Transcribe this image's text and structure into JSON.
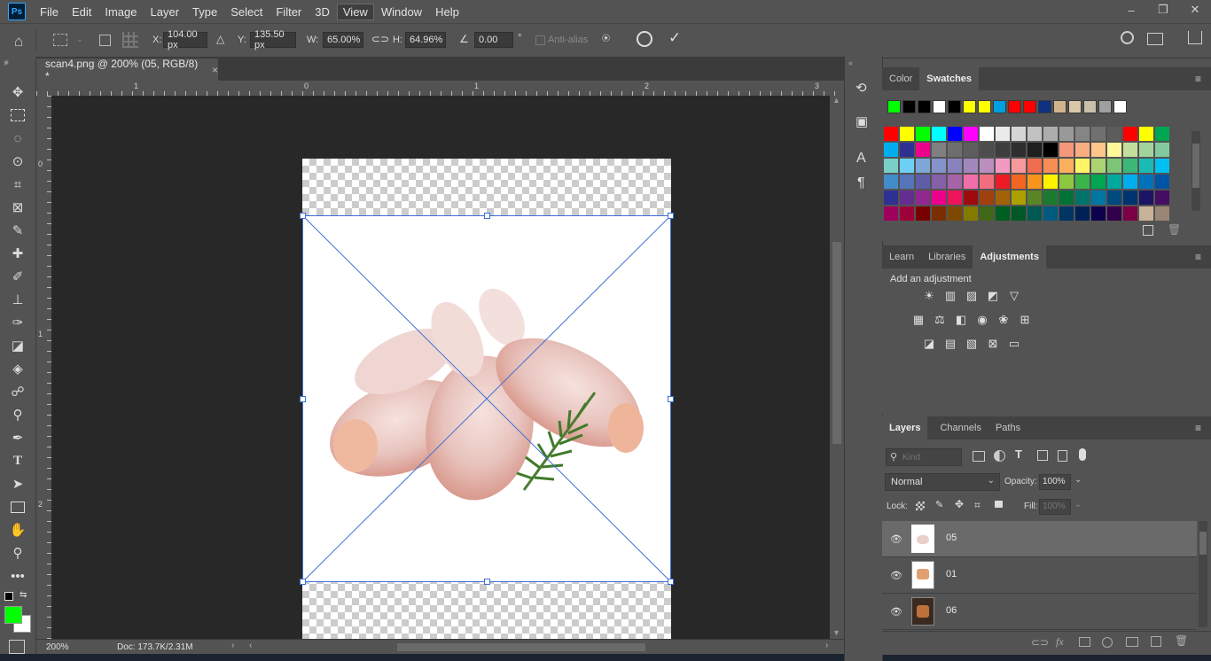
{
  "app": {
    "logo": "Ps"
  },
  "menu": [
    "File",
    "Edit",
    "Image",
    "Layer",
    "Type",
    "Select",
    "Filter",
    "3D",
    "View",
    "Window",
    "Help"
  ],
  "options": {
    "x_label": "X:",
    "x_value": "104.00 px",
    "y_label": "Y:",
    "y_value": "135.50 px",
    "w_label": "W:",
    "w_value": "65.00%",
    "h_label": "H:",
    "h_value": "64.96%",
    "angle_value": "0.00",
    "angle_unit": "°",
    "antialias_label": "Anti-alias"
  },
  "document": {
    "tab_title": "scan4.png @ 200% (05, RGB/8) *",
    "close_glyph": "×",
    "ruler_h": [
      "1",
      "0",
      "1",
      "2",
      "3"
    ],
    "ruler_v": [
      "0",
      "1",
      "2"
    ]
  },
  "status": {
    "zoom": "200%",
    "doc_size": "Doc: 173.7K/2.31M"
  },
  "colors": {
    "foreground": "#00ff00",
    "background": "#ffffff",
    "accent": "#3d6fd6"
  },
  "swatches_panel": {
    "tabs": [
      "Color",
      "Swatches"
    ],
    "active_tab": "Swatches",
    "recent": [
      "#00ff00",
      "#000000",
      "#000000",
      "#ffffff",
      "#000000",
      "#ffff00",
      "#ffff00",
      "#00a0e0",
      "#ff0000",
      "#ff0000",
      "#103080",
      "#d2b48c",
      "#d8c8a8",
      "#c8c0a8",
      "#a0a0a0",
      "#ffffff"
    ],
    "grid": [
      [
        "#ff0000",
        "#ffff00",
        "#00ff00",
        "#00ffff",
        "#0000ff",
        "#ff00ff",
        "#ffffff",
        "#ebebeb",
        "#d6d6d6",
        "#c2c2c2",
        "#adadad",
        "#999999",
        "#858585",
        "#707070",
        "#5c5c5c",
        "#ff0000",
        "#ffff00",
        "#00a651"
      ],
      [
        "#00aeef",
        "#2e3192",
        "#ec008c",
        "#808080",
        "#6e6e6e",
        "#5e5e5e",
        "#4d4d4d",
        "#3d3d3d",
        "#2e2e2e",
        "#1f1f1f",
        "#000000",
        "#f7977a",
        "#f9ad81",
        "#fdc68a",
        "#fff79a",
        "#c4df9b",
        "#a3d39c",
        "#82ca9d"
      ],
      [
        "#7bcdc8",
        "#6ecff6",
        "#7ea7d8",
        "#8493ca",
        "#8882be",
        "#a187be",
        "#bc8dbf",
        "#f49ac2",
        "#f6989d",
        "#f26c4f",
        "#f68e55",
        "#fbaf5c",
        "#fff467",
        "#acd372",
        "#7cc576",
        "#3bb878",
        "#1abbb4",
        "#00bff3"
      ],
      [
        "#438cca",
        "#5574b9",
        "#605ca8",
        "#855fa8",
        "#a763a8",
        "#f06ea9",
        "#f26d7d",
        "#ed1c24",
        "#f26522",
        "#f7941d",
        "#fff200",
        "#8dc63f",
        "#39b54a",
        "#00a651",
        "#00a99d",
        "#00aeef",
        "#0072bc",
        "#0054a6"
      ],
      [
        "#2e3192",
        "#662d91",
        "#92278f",
        "#ec008c",
        "#ed145b",
        "#9e0b0f",
        "#a0410d",
        "#a36209",
        "#aba000",
        "#598527",
        "#1a7b30",
        "#007236",
        "#00746b",
        "#0076a3",
        "#004a80",
        "#003471",
        "#1b1464",
        "#440e62"
      ],
      [
        "#9e005d",
        "#9e0039",
        "#790000",
        "#7b2e00",
        "#7d4900",
        "#827b00",
        "#406618",
        "#005e20",
        "#005826",
        "#005952",
        "#005b7f",
        "#003663",
        "#002157",
        "#0d004c",
        "#32004b",
        "#7b0046",
        "#c7b299",
        "#998675"
      ]
    ]
  },
  "adjustments_panel": {
    "tabs": [
      "Learn",
      "Libraries",
      "Adjustments"
    ],
    "active_tab": "Adjustments",
    "heading": "Add an adjustment",
    "row1": [
      "brightness-icon",
      "levels-icon",
      "curves-icon",
      "exposure-icon",
      "vibrance-icon"
    ],
    "row2": [
      "hue-saturation-icon",
      "color-balance-icon",
      "black-white-icon",
      "photo-filter-icon",
      "channel-mixer-icon",
      "color-lookup-icon"
    ],
    "row3": [
      "invert-icon",
      "posterize-icon",
      "threshold-icon",
      "selective-color-icon",
      "gradient-map-icon"
    ]
  },
  "layers_panel": {
    "tabs": [
      "Layers",
      "Channels",
      "Paths"
    ],
    "active_tab": "Layers",
    "filter_placeholder": "Kind",
    "blend_mode": "Normal",
    "opacity_label": "Opacity:",
    "opacity_value": "100%",
    "lock_label": "Lock:",
    "fill_label": "Fill:",
    "fill_value": "100%",
    "layers": [
      {
        "name": "05",
        "selected": true
      },
      {
        "name": "01",
        "selected": false
      },
      {
        "name": "06",
        "selected": false
      }
    ]
  }
}
